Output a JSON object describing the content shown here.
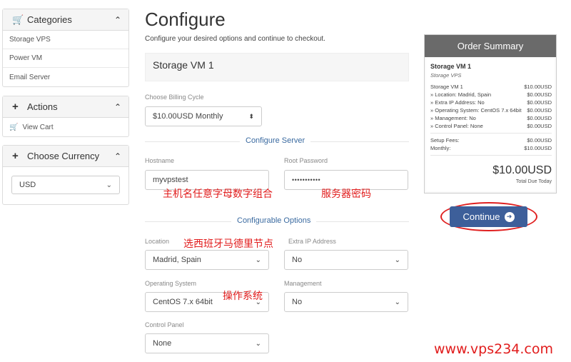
{
  "sidebar": {
    "categories": {
      "title": "Categories",
      "items": [
        "Storage VPS",
        "Power VM",
        "Email Server"
      ]
    },
    "actions": {
      "title": "Actions",
      "view_cart": "View Cart"
    },
    "currency": {
      "title": "Choose Currency",
      "selected": "USD"
    }
  },
  "main": {
    "title": "Configure",
    "subtitle": "Configure your desired options and continue to checkout.",
    "product_name": "Storage VM 1",
    "billing_label": "Choose Billing Cycle",
    "billing_value": "$10.00USD Monthly",
    "server_section": "Configure Server",
    "hostname_label": "Hostname",
    "hostname_value": "myvpstest",
    "password_label": "Root Password",
    "password_value": "•••••••••••",
    "options_section": "Configurable Options",
    "location_label": "Location",
    "location_value": "Madrid, Spain",
    "extra_ip_label": "Extra IP Address",
    "extra_ip_value": "No",
    "os_label": "Operating System",
    "os_value": "CentOS 7.x 64bit",
    "management_label": "Management",
    "management_value": "No",
    "cpanel_label": "Control Panel",
    "cpanel_value": "None"
  },
  "summary": {
    "title": "Order Summary",
    "product": "Storage VM 1",
    "group": "Storage VPS",
    "rows": [
      {
        "label": "Storage VM 1",
        "value": "$10.00USD"
      },
      {
        "label": "» Location: Madrid, Spain",
        "value": "$0.00USD"
      },
      {
        "label": "» Extra IP Address: No",
        "value": "$0.00USD"
      },
      {
        "label": "» Operating System: CentOS 7.x 64bit",
        "value": "$0.00USD"
      },
      {
        "label": "» Management: No",
        "value": "$0.00USD"
      },
      {
        "label": "» Control Panel: None",
        "value": "$0.00USD"
      }
    ],
    "setup_label": "Setup Fees:",
    "setup_value": "$0.00USD",
    "monthly_label": "Monthly:",
    "monthly_value": "$10.00USD",
    "total": "$10.00USD",
    "total_due": "Total Due Today"
  },
  "continue_label": "Continue",
  "annotations": {
    "hostname_note": "主机名任意字母数字组合",
    "password_note": "服务器密码",
    "location_note": "选西班牙马德里节点",
    "os_note": "操作系统"
  },
  "watermark": "www.vps234.com",
  "colors": {
    "accent": "#3d5f9a",
    "annotation": "#e11c1c",
    "summary_header": "#6a6a6a"
  }
}
